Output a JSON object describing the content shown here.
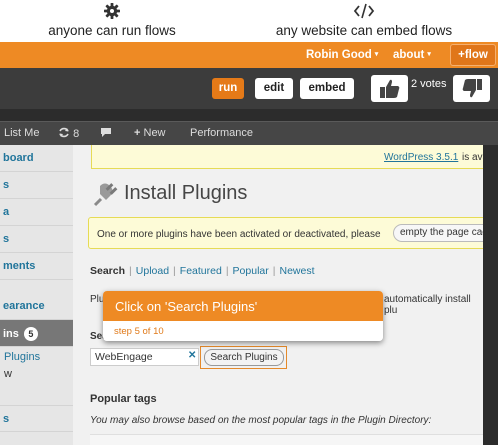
{
  "promo": {
    "left_text": "anyone can run flows",
    "right_text": "any website can embed flows",
    "left_icon": "gear-icon",
    "right_icon": "code-icon"
  },
  "nav": {
    "user": "Robin Good",
    "about": "about",
    "caret": "▾",
    "flow_button": "+flow"
  },
  "toolbar": {
    "run": "run",
    "edit": "edit",
    "embed": "embed",
    "votes": "2 votes"
  },
  "wp": {
    "adminbar": {
      "list_me": "List Me",
      "updates_count": "8",
      "new": "New",
      "performance": "Performance"
    },
    "sidebar": {
      "dashboard": "board",
      "item_s1": "s",
      "item_a": "a",
      "item_s2": "s",
      "comments": "ments",
      "appearance": "earance",
      "plugins": "ins",
      "plugins_badge": "5",
      "installed_plugins": "Plugins",
      "add_new": "w",
      "item_s3": "s"
    },
    "update_link": "WordPress 3.5.1",
    "update_rest": "is ava",
    "title": "Install Plugins",
    "notice": "One or more plugins have been activated or deactivated, please",
    "empty_cache": "empty the page cache",
    "subnav": {
      "search": "Search",
      "upload": "Upload",
      "featured": "Featured",
      "popular": "Popular",
      "newest": "Newest",
      "sep": "|"
    },
    "desc_left": "Plu",
    "desc_right": "automatically install plu",
    "search_label": "Sea",
    "search_value": "WebEngage",
    "clear": "✕",
    "search_button": "Search Plugins",
    "popular_heading": "Popular tags",
    "popular_text": "You may also browse based on the most popular tags in the Plugin Directory:"
  },
  "tooltip": {
    "title": "Click on 'Search Plugins'",
    "step": "step 5 of 10"
  },
  "colors": {
    "accent": "#ee8a24",
    "dark": "#3c3c3c",
    "wp_link": "#21759b"
  }
}
